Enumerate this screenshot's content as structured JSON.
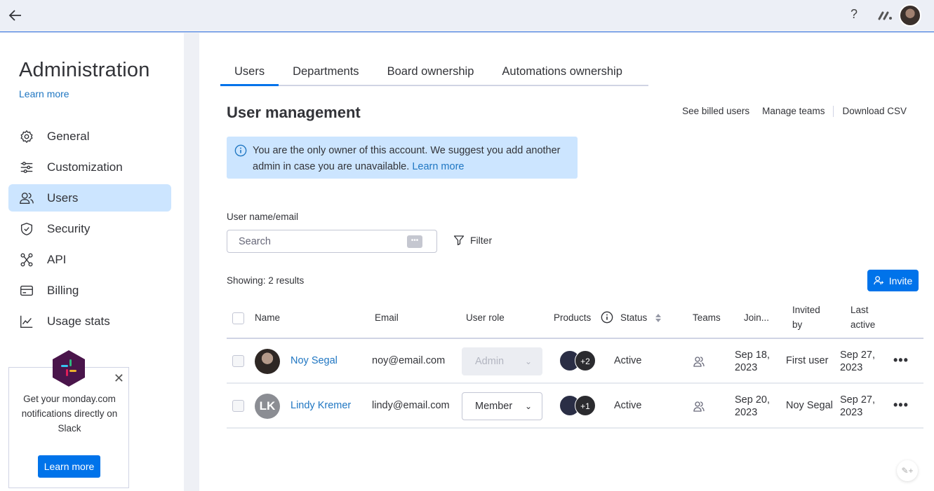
{
  "topbar": {
    "help": "?"
  },
  "sidebar": {
    "title": "Administration",
    "learn_more": "Learn more",
    "items": [
      {
        "label": "General",
        "icon": "gear-icon"
      },
      {
        "label": "Customization",
        "icon": "sliders-icon"
      },
      {
        "label": "Users",
        "icon": "users-icon",
        "active": true
      },
      {
        "label": "Security",
        "icon": "shield-icon"
      },
      {
        "label": "API",
        "icon": "api-icon"
      },
      {
        "label": "Billing",
        "icon": "credit-card-icon"
      },
      {
        "label": "Usage stats",
        "icon": "chart-line-icon"
      }
    ]
  },
  "promo": {
    "text": "Get your monday.com notifications directly on Slack",
    "button": "Learn more",
    "close": "✕"
  },
  "main": {
    "tabs": [
      "Users",
      "Departments",
      "Board ownership",
      "Automations ownership"
    ],
    "title": "User management",
    "links": [
      "See billed users",
      "Manage teams",
      "Download CSV"
    ],
    "alert": {
      "text": "You are the only owner of this account. We suggest you add another admin in case you are unavailable.",
      "link": "Learn more"
    },
    "search": {
      "label": "User name/email",
      "placeholder": "Search",
      "value": ""
    },
    "filter": "Filter",
    "showing": "Showing: 2 results",
    "invite": "Invite"
  },
  "table": {
    "columns": {
      "name": "Name",
      "email": "Email",
      "role": "User role",
      "products": "Products",
      "status": "Status",
      "teams": "Teams",
      "joined": "Join...",
      "invited_by_1": "Invited",
      "invited_by_2": "by",
      "last_active_1": "Last",
      "last_active_2": "active"
    },
    "rows": [
      {
        "name": "Noy Segal",
        "email": "noy@email.com",
        "role": "Admin",
        "products_extra": "+2",
        "status": "Active",
        "joined_1": "Sep 18,",
        "joined_2": "2023",
        "invited_by": "First user",
        "last_active_1": "Sep 27,",
        "last_active_2": "2023"
      },
      {
        "name": "Lindy Kremer",
        "initials": "LK",
        "email": "lindy@email.com",
        "role": "Member",
        "products_extra": "+1",
        "status": "Active",
        "joined_1": "Sep 20,",
        "joined_2": "2023",
        "invited_by": "Noy Segal",
        "last_active_1": "Sep 27,",
        "last_active_2": "2023"
      }
    ]
  },
  "colors": {
    "accent": "#0073ea",
    "link": "#1f76c2",
    "alert_bg": "#cce5ff",
    "active_nav": "#cce5ff"
  }
}
